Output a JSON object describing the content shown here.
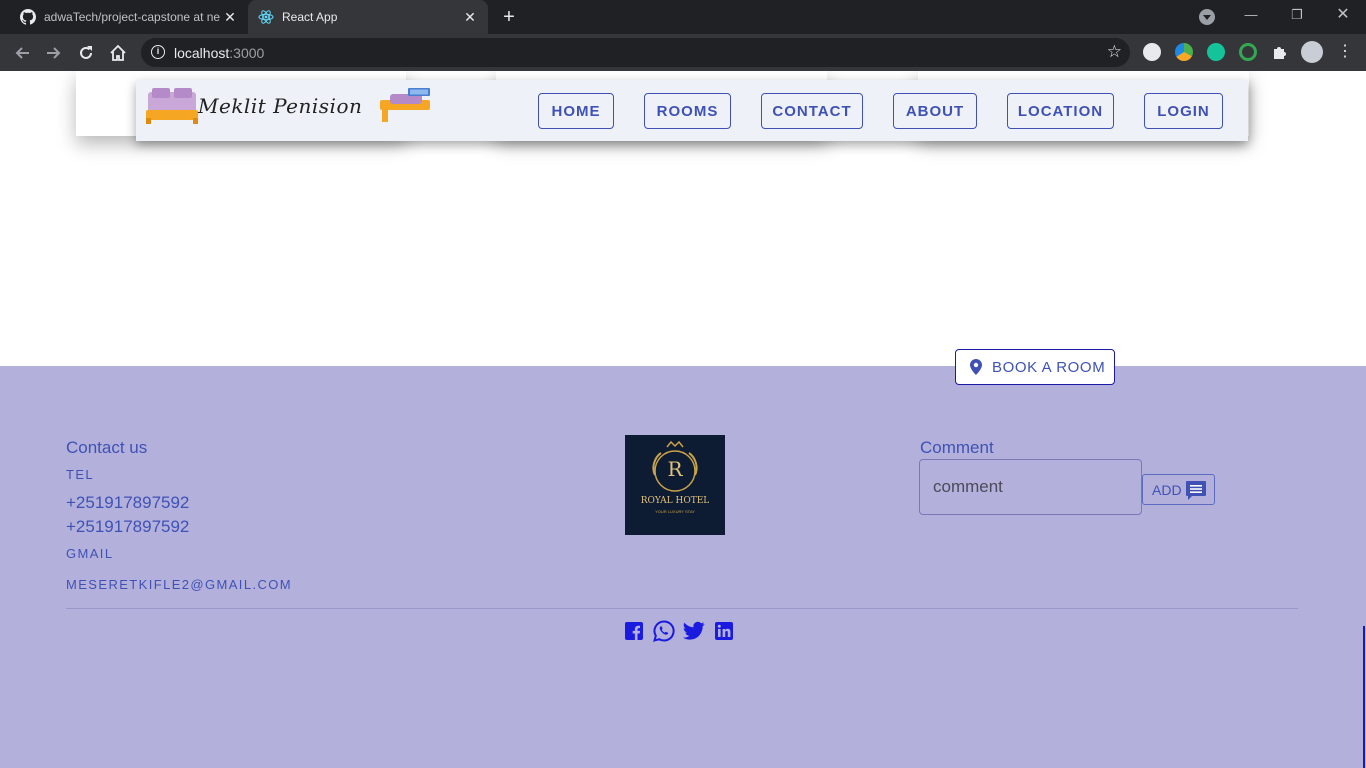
{
  "browser": {
    "tabs": [
      {
        "title": "adwaTech/project-capstone at ne",
        "icon": "github-icon",
        "active": false
      },
      {
        "title": "React App",
        "icon": "react-icon",
        "active": true
      }
    ],
    "url_host": "localhost",
    "url_port": ":3000"
  },
  "nav": {
    "logo_text": "Meklit Penision",
    "links": [
      "HOME",
      "ROOMS",
      "CONTACT",
      "ABOUT",
      "LOCATION",
      "LOGIN"
    ]
  },
  "book": {
    "label": "BOOK A ROOM",
    "icon": "location-pin-icon"
  },
  "footer": {
    "contact_heading": "Contact us",
    "tel_label": "TEL",
    "phones": [
      "+251917897592",
      "+251917897592"
    ],
    "gmail_label": "GMAIL",
    "email": "MESERETKIFLE2@GMAIL.COM",
    "hotel_logo": {
      "letter": "R",
      "name": "ROYAL HOTEL",
      "tagline": "YOUR LUXURY STAY"
    },
    "comment_heading": "Comment",
    "comment_placeholder": "comment",
    "add_label": "ADD",
    "social_icons": [
      "facebook-icon",
      "whatsapp-icon",
      "twitter-icon",
      "linkedin-icon"
    ]
  },
  "colors": {
    "accent": "#3f51b5",
    "footer_bg": "#b3b1db",
    "social": "#1a1ae0",
    "chrome_dark": "#202124",
    "chrome_toolbar": "#35363a"
  }
}
